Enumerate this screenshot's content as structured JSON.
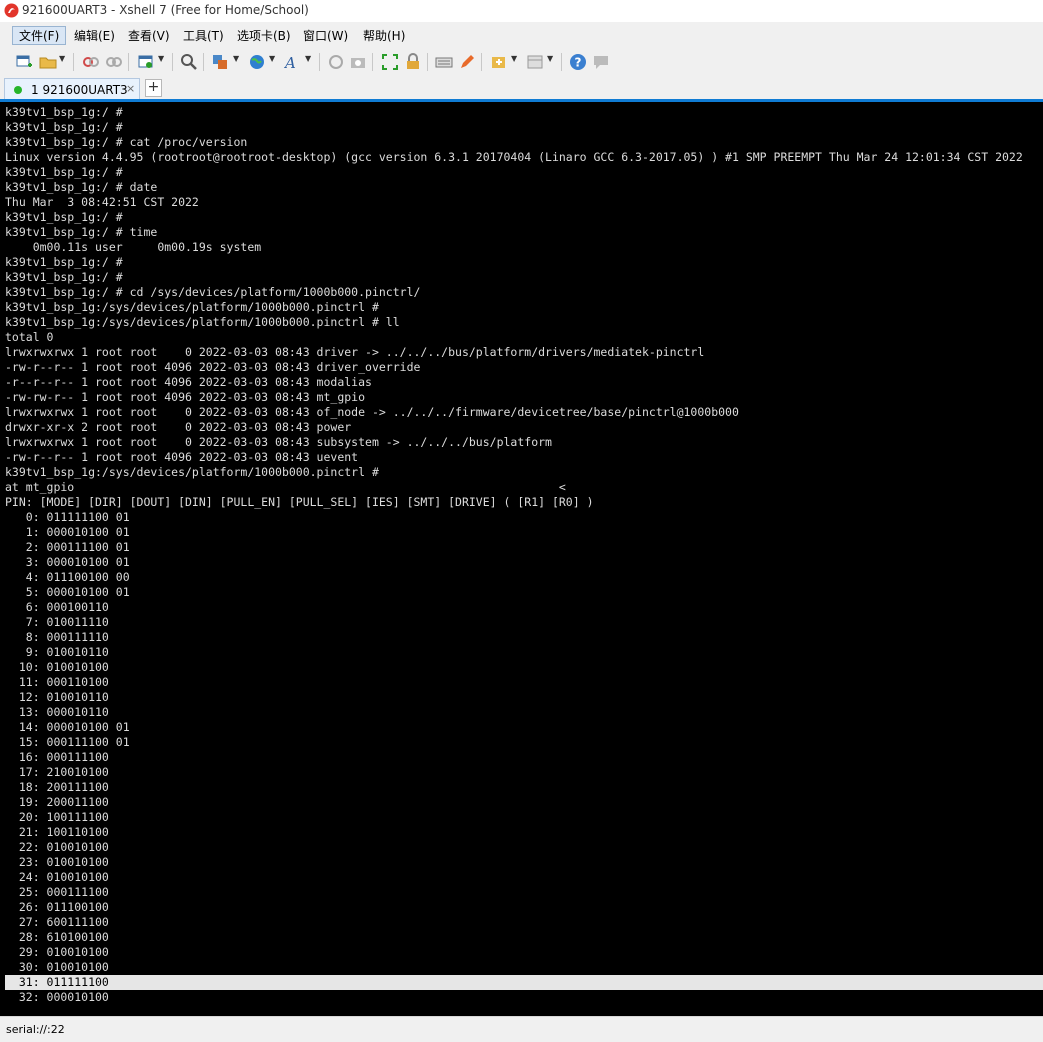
{
  "window": {
    "title": "921600UART3 - Xshell 7 (Free for Home/School)"
  },
  "menu": [
    {
      "label": "文件(F)"
    },
    {
      "label": "编辑(E)"
    },
    {
      "label": "查看(V)"
    },
    {
      "label": "工具(T)"
    },
    {
      "label": "选项卡(B)"
    },
    {
      "label": "窗口(W)"
    },
    {
      "label": "帮助(H)"
    }
  ],
  "toolbar_icons": [
    "new-session-icon",
    "open-folder-icon",
    "disconnect-icon",
    "reconnect-icon",
    "properties-icon",
    "find-icon",
    "transfer-icon",
    "globe-icon",
    "font-icon",
    "color-scheme-icon",
    "screenshot-icon",
    "fullscreen-icon",
    "lock-icon",
    "keyboard-icon",
    "highlight-icon",
    "add-script-icon",
    "layout-icon",
    "help-icon",
    "chat-icon"
  ],
  "tab": {
    "label": "1 921600UART3",
    "close": "×",
    "add": "+"
  },
  "terminal": {
    "lines": [
      "k39tv1_bsp_1g:/ #",
      "k39tv1_bsp_1g:/ #",
      "k39tv1_bsp_1g:/ # cat /proc/version",
      "Linux version 4.4.95 (rootroot@rootroot-desktop) (gcc version 6.3.1 20170404 (Linaro GCC 6.3-2017.05) ) #1 SMP PREEMPT Thu Mar 24 12:01:34 CST 2022",
      "k39tv1_bsp_1g:/ #",
      "k39tv1_bsp_1g:/ # date",
      "Thu Mar  3 08:42:51 CST 2022",
      "k39tv1_bsp_1g:/ #",
      "k39tv1_bsp_1g:/ # time",
      "    0m00.11s user     0m00.19s system",
      "k39tv1_bsp_1g:/ #",
      "k39tv1_bsp_1g:/ #",
      "k39tv1_bsp_1g:/ # cd /sys/devices/platform/1000b000.pinctrl/",
      "k39tv1_bsp_1g:/sys/devices/platform/1000b000.pinctrl #",
      "k39tv1_bsp_1g:/sys/devices/platform/1000b000.pinctrl # ll",
      "total 0",
      "lrwxrwxrwx 1 root root    0 2022-03-03 08:43 driver -> ../../../bus/platform/drivers/mediatek-pinctrl",
      "-rw-r--r-- 1 root root 4096 2022-03-03 08:43 driver_override",
      "-r--r--r-- 1 root root 4096 2022-03-03 08:43 modalias",
      "-rw-rw-r-- 1 root root 4096 2022-03-03 08:43 mt_gpio",
      "lrwxrwxrwx 1 root root    0 2022-03-03 08:43 of_node -> ../../../firmware/devicetree/base/pinctrl@1000b000",
      "drwxr-xr-x 2 root root    0 2022-03-03 08:43 power",
      "lrwxrwxrwx 1 root root    0 2022-03-03 08:43 subsystem -> ../../../bus/platform",
      "-rw-r--r-- 1 root root 4096 2022-03-03 08:43 uevent",
      "k39tv1_bsp_1g:/sys/devices/platform/1000b000.pinctrl #",
      "at mt_gpio                                                                      <",
      "PIN: [MODE] [DIR] [DOUT] [DIN] [PULL_EN] [PULL_SEL] [IES] [SMT] [DRIVE] ( [R1] [R0] )",
      "   0: 011111100 01",
      "   1: 000010100 01",
      "   2: 000111100 01",
      "   3: 000010100 01",
      "   4: 011100100 00",
      "   5: 000010100 01",
      "   6: 000100110",
      "   7: 010011110",
      "   8: 000111110",
      "   9: 010010110",
      "  10: 010010100",
      "  11: 000110100",
      "  12: 010010110",
      "  13: 000010110",
      "  14: 000010100 01",
      "  15: 000111100 01",
      "  16: 000111100",
      "  17: 210010100",
      "  18: 200111100",
      "  19: 200011100",
      "  20: 100111100",
      "  21: 100110100",
      "  22: 010010100",
      "  23: 010010100",
      "  24: 010010100",
      "  25: 000111100",
      "  26: 011100100",
      "  27: 600111100",
      "  28: 610100100",
      "  29: 010010100",
      "  30: 010010100",
      "  31: 011111100",
      "  32: 000010100"
    ],
    "highlighted_line": 58
  },
  "status": {
    "text": "serial://:22"
  },
  "colors": {
    "tab_accent": "#0f7bd3",
    "connected_dot": "#27b52a",
    "terminal_bg": "#000000",
    "terminal_fg": "#dcdcdc"
  }
}
